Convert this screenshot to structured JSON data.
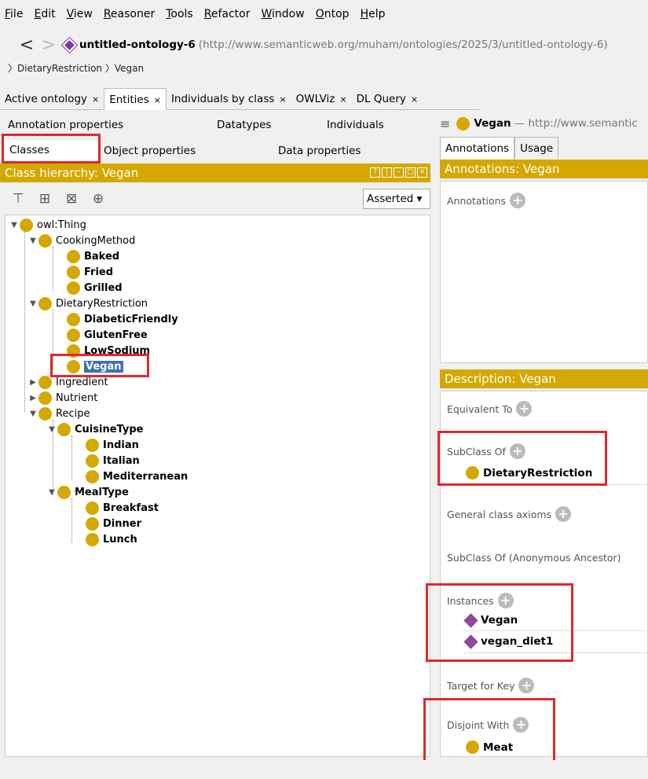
{
  "menu": [
    {
      "u": "F",
      "rest": "ile"
    },
    {
      "u": "E",
      "rest": "dit"
    },
    {
      "u": "V",
      "rest": "iew"
    },
    {
      "u": "R",
      "rest": "easoner"
    },
    {
      "u": "T",
      "rest": "ools"
    },
    {
      "u": "R",
      "rest": "efactor"
    },
    {
      "u": "W",
      "rest": "indow"
    },
    {
      "u": "O",
      "rest": "ntop"
    },
    {
      "u": "H",
      "rest": "elp"
    }
  ],
  "nav": {
    "back": "<",
    "forward": ">",
    "ontology_name": "untitled-ontology-6",
    "ontology_iri": "(http://www.semanticweb.org/muham/ontologies/2025/3/untitled-ontology-6)",
    "breadcrumb": "〉DietaryRestriction 〉Vegan"
  },
  "tabs": [
    {
      "label": "Active ontology",
      "close": "×"
    },
    {
      "label": "Entities",
      "close": "×"
    },
    {
      "label": "Individuals by class",
      "close": "×"
    },
    {
      "label": "OWLViz",
      "close": "×"
    },
    {
      "label": "DL Query",
      "close": "×"
    }
  ],
  "subtabs": {
    "annotation_properties": "Annotation properties",
    "datatypes": "Datatypes",
    "individuals": "Individuals",
    "classes": "Classes",
    "object_properties": "Object properties",
    "data_properties": "Data properties"
  },
  "left": {
    "header": "Class hierarchy: Vegan",
    "dropdown": "Asserted",
    "tree": [
      {
        "label": "owl:Thing",
        "bold": false,
        "toggle": "▼"
      },
      {
        "label": "CookingMethod",
        "bold": false,
        "toggle": "▼"
      },
      {
        "label": "Baked",
        "bold": true
      },
      {
        "label": "Fried",
        "bold": true
      },
      {
        "label": "Grilled",
        "bold": true
      },
      {
        "label": "DietaryRestriction",
        "bold": false,
        "toggle": "▼"
      },
      {
        "label": "DiabeticFriendly",
        "bold": true
      },
      {
        "label": "GlutenFree",
        "bold": true
      },
      {
        "label": "LowSodium",
        "bold": true
      },
      {
        "label": "Vegan",
        "bold": true,
        "selected": true
      },
      {
        "label": "Ingredient",
        "bold": false,
        "toggle": "▶"
      },
      {
        "label": "Nutrient",
        "bold": false,
        "toggle": "▶"
      },
      {
        "label": "Recipe",
        "bold": false,
        "toggle": "▼"
      },
      {
        "label": "CuisineType",
        "bold": true,
        "toggle": "▼"
      },
      {
        "label": "Indian",
        "bold": true
      },
      {
        "label": "Italian",
        "bold": true
      },
      {
        "label": "Mediterranean",
        "bold": true
      },
      {
        "label": "MealType",
        "bold": true,
        "toggle": "▼"
      },
      {
        "label": "Breakfast",
        "bold": true
      },
      {
        "label": "Dinner",
        "bold": true
      },
      {
        "label": "Lunch",
        "bold": true
      }
    ]
  },
  "right": {
    "entity_name": "Vegan",
    "entity_iri": "— http://www.semantic",
    "tabs": [
      "Annotations",
      "Usage"
    ],
    "annotations_header": "Annotations: Vegan",
    "annotations_label": "Annotations",
    "description_header": "Description: Vegan",
    "equivalent_to": "Equivalent To",
    "subclass_of": "SubClass Of",
    "subclass_entry": "DietaryRestriction",
    "general_axioms": "General class axioms",
    "anon_ancestor": "SubClass Of (Anonymous Ancestor)",
    "instances": "Instances",
    "instance_entries": [
      "Vegan",
      "vegan_diet1"
    ],
    "target_for_key": "Target for Key",
    "disjoint_with": "Disjoint With",
    "disjoint_entry": "Meat",
    "plus": "+"
  },
  "colors": {
    "accent": "#d4a800",
    "highlight": "#e0282e",
    "selection": "#3f6fb0",
    "individual": "#8b4a9a"
  }
}
